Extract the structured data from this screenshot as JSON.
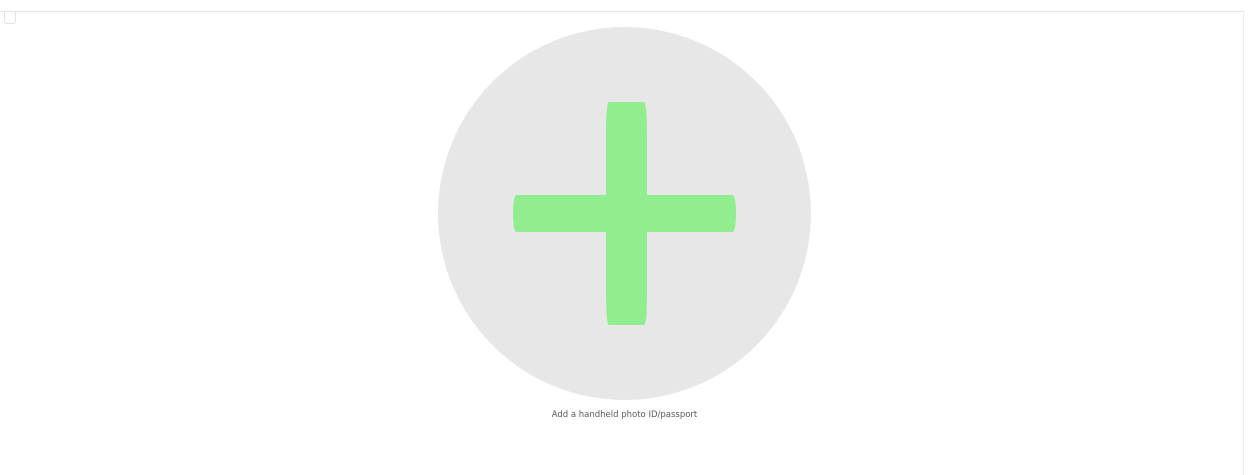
{
  "upload": {
    "label": "Add a handheld photo ID/passport",
    "icon": "plus-icon"
  },
  "colors": {
    "circle_background": "#e7e7e7",
    "plus_color": "#90ee90",
    "label_color": "#5a5a5a"
  }
}
